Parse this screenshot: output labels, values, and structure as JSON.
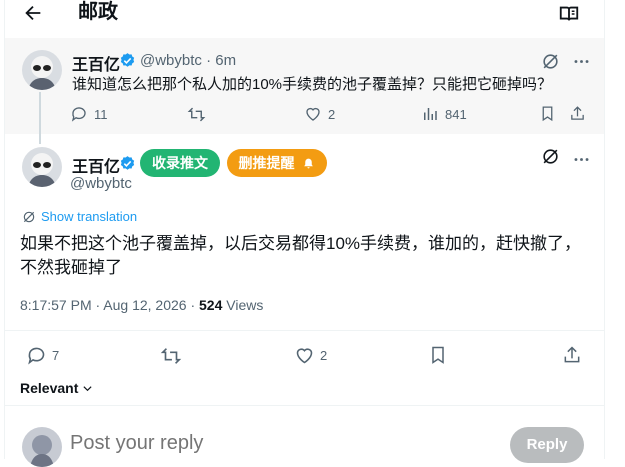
{
  "header": {
    "title": "邮政"
  },
  "parent_post": {
    "name": "王百亿",
    "handle": "@wbybtc · 6m",
    "text": "谁知道怎么把那个私人加的10%手续费的池子覆盖掉？只能把它砸掉吗？",
    "replies": "11",
    "likes": "2",
    "views": "841"
  },
  "main_post": {
    "name": "王百亿",
    "handle": "@wbybtc",
    "pill_collect": "收录推文",
    "pill_remind": "删推提醒",
    "show_translation": "Show translation",
    "text": "如果不把这个池子覆盖掉，以后交易都得10%手续费，谁加的，赶快撤了，不然我砸掉了",
    "timestamp": "8:17:57 PM · Aug 12, 2026 · ",
    "views_count": "524",
    "views_label": " Views",
    "replies": "7",
    "likes": "2"
  },
  "sort": {
    "label": "Relevant"
  },
  "composer": {
    "placeholder": "Post your reply",
    "button": "Reply"
  },
  "colors": {
    "accent": "#1d9bf0",
    "green_pill": "#22b573",
    "orange_pill": "#f39c12"
  }
}
